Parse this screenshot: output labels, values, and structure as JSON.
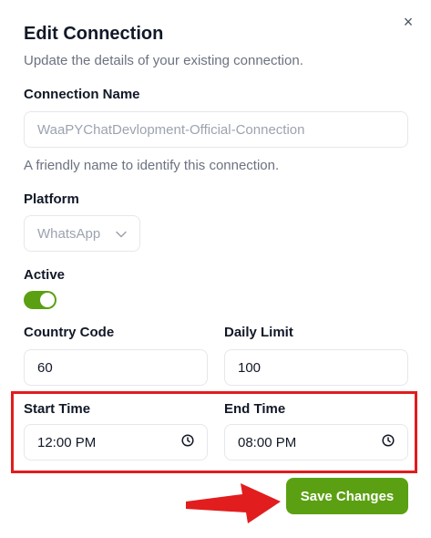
{
  "dialog": {
    "title": "Edit Connection",
    "subtitle": "Update the details of your existing connection.",
    "close_symbol": "×"
  },
  "fields": {
    "connection_name": {
      "label": "Connection Name",
      "value": "WaaPYChatDevlopment-Official-Connection",
      "hint": "A friendly name to identify this connection."
    },
    "platform": {
      "label": "Platform",
      "value": "WhatsApp"
    },
    "active": {
      "label": "Active",
      "enabled": true
    },
    "country_code": {
      "label": "Country Code",
      "value": "60"
    },
    "daily_limit": {
      "label": "Daily Limit",
      "value": "100"
    },
    "start_time": {
      "label": "Start Time",
      "value": "12:00 PM"
    },
    "end_time": {
      "label": "End Time",
      "value": "08:00 PM"
    }
  },
  "actions": {
    "save_label": "Save Changes"
  },
  "colors": {
    "accent_green": "#5ba012",
    "highlight_red": "#e11d1d"
  },
  "icons": {
    "close": "close-icon",
    "chevron": "chevron-down-icon",
    "clock": "clock-icon",
    "arrow": "red-arrow-annotation"
  }
}
